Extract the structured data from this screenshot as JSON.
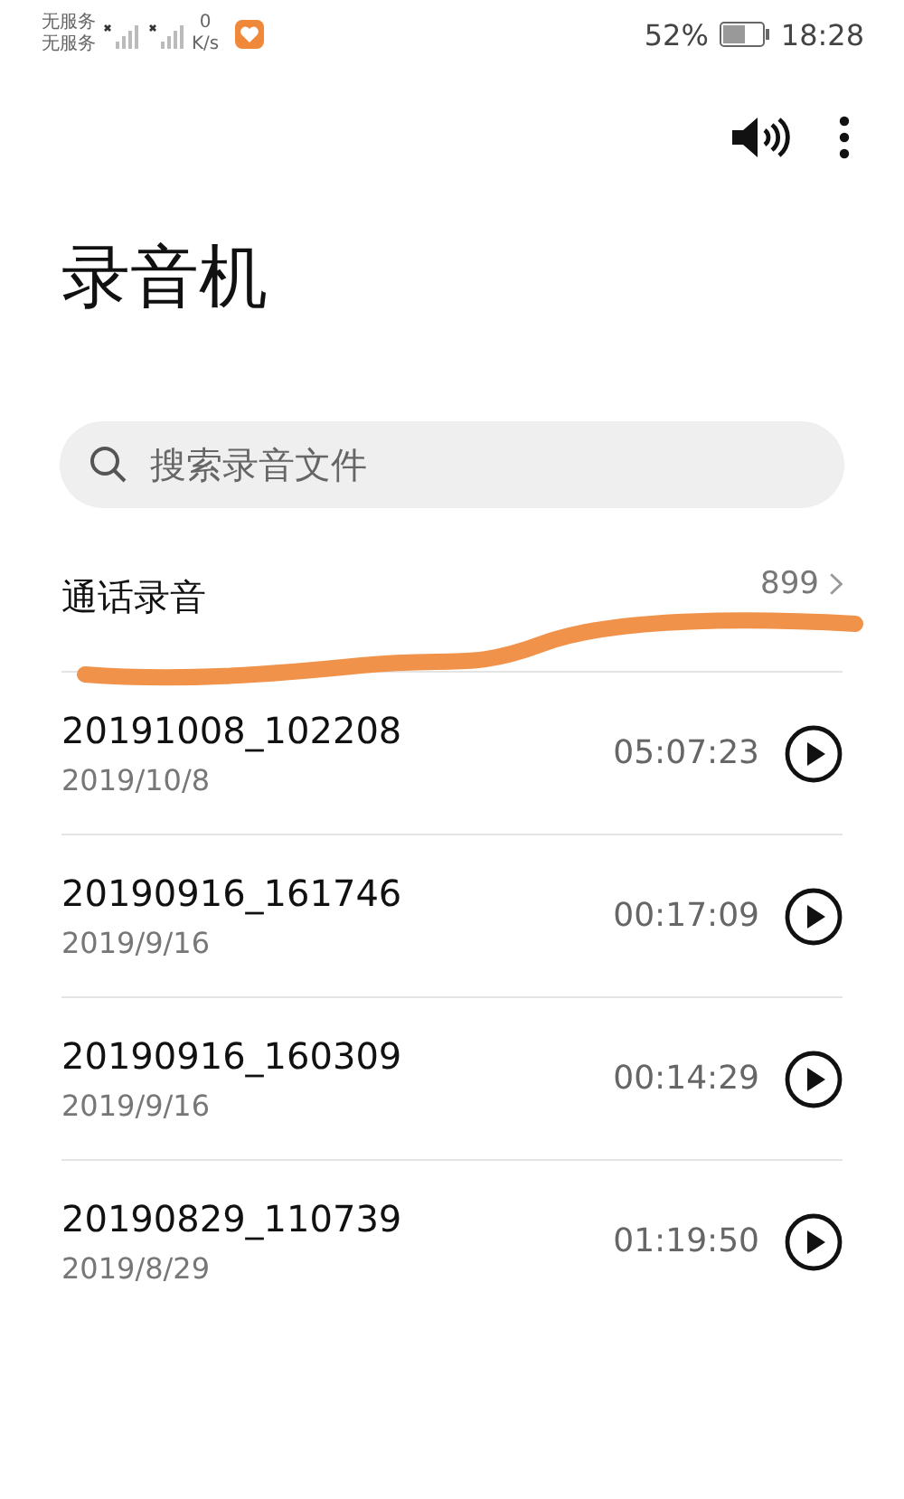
{
  "status_bar": {
    "carrier_1": "无服务",
    "carrier_2": "无服务",
    "speed_value": "0",
    "speed_unit": "K/s",
    "battery": "52%",
    "time": "18:28"
  },
  "title": "录音机",
  "search": {
    "placeholder": "搜索录音文件"
  },
  "call_recordings": {
    "label": "通话录音",
    "count": "899"
  },
  "recordings": [
    {
      "name": "20191008_102208",
      "date": "2019/10/8",
      "duration": "05:07:23"
    },
    {
      "name": "20190916_161746",
      "date": "2019/9/16",
      "duration": "00:17:09"
    },
    {
      "name": "20190916_160309",
      "date": "2019/9/16",
      "duration": "00:14:29"
    },
    {
      "name": "20190829_110739",
      "date": "2019/8/29",
      "duration": "01:19:50"
    }
  ]
}
